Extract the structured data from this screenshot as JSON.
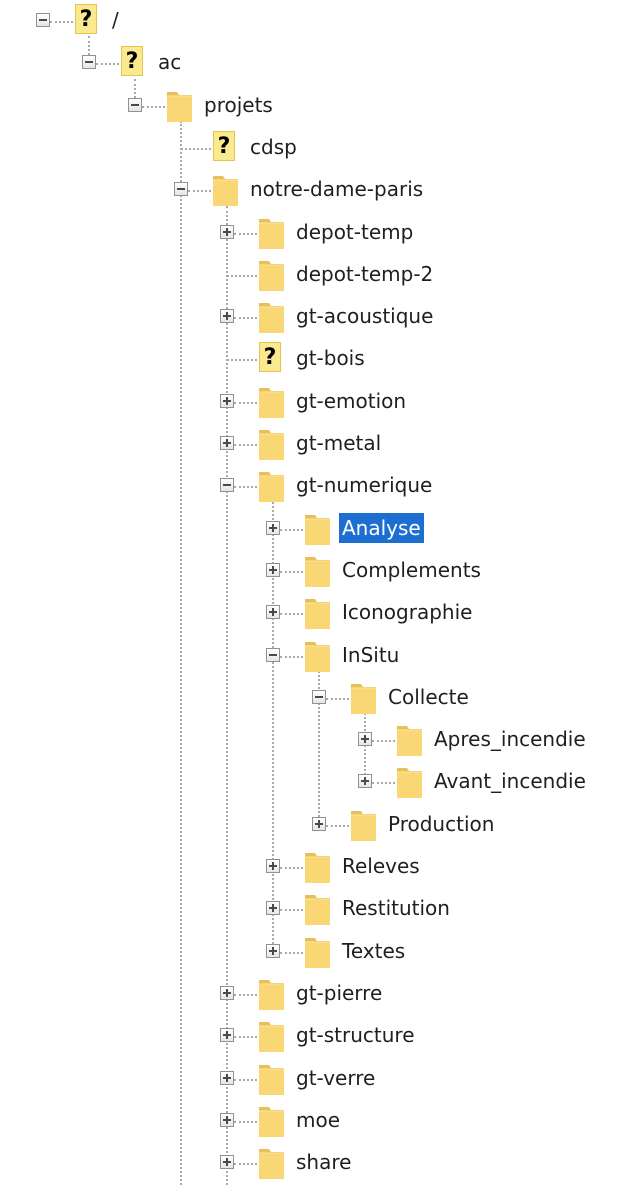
{
  "colors": {
    "selection_background": "#1c6fd0",
    "selection_text": "#ffffff",
    "folder": "#f8d774",
    "unknown_badge": "#fbe98f",
    "tree_lines": "#a9a9a9"
  },
  "icons": {
    "folder": "folder-icon",
    "unknown": "question-mark-icon",
    "expanded": "minus-box-icon",
    "collapsed": "plus-box-icon"
  },
  "tree": [
    {
      "label": "/",
      "depth": 0,
      "icon": "unknown",
      "toggle": "expanded"
    },
    {
      "label": "ac",
      "depth": 1,
      "icon": "unknown",
      "toggle": "expanded"
    },
    {
      "label": "projets",
      "depth": 2,
      "icon": "folder",
      "toggle": "expanded"
    },
    {
      "label": "cdsp",
      "depth": 3,
      "icon": "unknown",
      "toggle": "none"
    },
    {
      "label": "notre-dame-paris",
      "depth": 3,
      "icon": "folder",
      "toggle": "expanded"
    },
    {
      "label": "depot-temp",
      "depth": 4,
      "icon": "folder",
      "toggle": "collapsed"
    },
    {
      "label": "depot-temp-2",
      "depth": 4,
      "icon": "folder",
      "toggle": "none"
    },
    {
      "label": "gt-acoustique",
      "depth": 4,
      "icon": "folder",
      "toggle": "collapsed"
    },
    {
      "label": "gt-bois",
      "depth": 4,
      "icon": "unknown",
      "toggle": "none"
    },
    {
      "label": "gt-emotion",
      "depth": 4,
      "icon": "folder",
      "toggle": "collapsed"
    },
    {
      "label": "gt-metal",
      "depth": 4,
      "icon": "folder",
      "toggle": "collapsed"
    },
    {
      "label": "gt-numerique",
      "depth": 4,
      "icon": "folder",
      "toggle": "expanded"
    },
    {
      "label": "Analyse",
      "depth": 5,
      "icon": "folder",
      "toggle": "collapsed",
      "selected": true
    },
    {
      "label": "Complements",
      "depth": 5,
      "icon": "folder",
      "toggle": "collapsed"
    },
    {
      "label": "Iconographie",
      "depth": 5,
      "icon": "folder",
      "toggle": "collapsed"
    },
    {
      "label": "InSitu",
      "depth": 5,
      "icon": "folder",
      "toggle": "expanded"
    },
    {
      "label": "Collecte",
      "depth": 6,
      "icon": "folder",
      "toggle": "expanded"
    },
    {
      "label": "Apres_incendie",
      "depth": 7,
      "icon": "folder",
      "toggle": "collapsed"
    },
    {
      "label": "Avant_incendie",
      "depth": 7,
      "icon": "folder",
      "toggle": "collapsed"
    },
    {
      "label": "Production",
      "depth": 6,
      "icon": "folder",
      "toggle": "collapsed"
    },
    {
      "label": "Releves",
      "depth": 5,
      "icon": "folder",
      "toggle": "collapsed"
    },
    {
      "label": "Restitution",
      "depth": 5,
      "icon": "folder",
      "toggle": "collapsed"
    },
    {
      "label": "Textes",
      "depth": 5,
      "icon": "folder",
      "toggle": "collapsed"
    },
    {
      "label": "gt-pierre",
      "depth": 4,
      "icon": "folder",
      "toggle": "collapsed"
    },
    {
      "label": "gt-structure",
      "depth": 4,
      "icon": "folder",
      "toggle": "collapsed"
    },
    {
      "label": "gt-verre",
      "depth": 4,
      "icon": "folder",
      "toggle": "collapsed"
    },
    {
      "label": "moe",
      "depth": 4,
      "icon": "folder",
      "toggle": "collapsed"
    },
    {
      "label": "share",
      "depth": 4,
      "icon": "folder",
      "toggle": "collapsed"
    }
  ]
}
